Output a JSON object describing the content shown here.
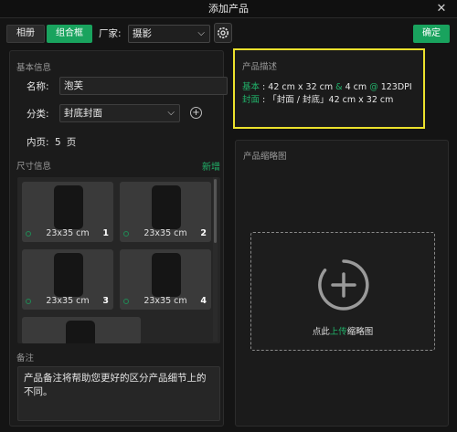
{
  "window": {
    "title": "添加产品",
    "close_glyph": "✕"
  },
  "toolbar": {
    "album_label": "相册",
    "combo_label": "组合框",
    "vendor_label": "厂家:",
    "vendor_value": "摄影",
    "confirm_label": "确定"
  },
  "basic_info": {
    "section_title": "基本信息",
    "name_label": "名称:",
    "name_value": "泡芙",
    "category_label": "分类:",
    "category_value": "封底封面",
    "pages_label": "内页:",
    "pages_value": "5",
    "pages_unit": "页"
  },
  "size_info": {
    "section_title": "尺寸信息",
    "add_label": "新增",
    "cards": [
      {
        "dims": "23x35 cm",
        "index": "1"
      },
      {
        "dims": "23x35 cm",
        "index": "2"
      },
      {
        "dims": "23x35 cm",
        "index": "3"
      },
      {
        "dims": "23x35 cm",
        "index": "4"
      }
    ]
  },
  "remarks": {
    "section_title": "备注",
    "text": "产品备注将帮助您更好的区分产品细节上的不同。"
  },
  "description": {
    "section_title": "产品描述",
    "basic_label": "基本",
    "basic_sep": ":",
    "basic_size": "42 cm x 32 cm",
    "amp": "&",
    "basic_depth": "4 cm",
    "at": "@",
    "dpi": "123DPI",
    "cover_label": "封面",
    "cover_sep": ":",
    "cover_value": "「封面 / 封底」42 cm x 32 cm"
  },
  "thumbnail": {
    "section_title": "产品缩略图",
    "upload_prefix": "点此",
    "upload_link": "上传",
    "upload_suffix": "缩略图"
  },
  "colors": {
    "accent": "#19a35e",
    "highlight_border": "#ece12c"
  },
  "icons": {
    "vendor_settings": "gear-icon",
    "add_category": "plus-circle-icon",
    "upload": "plus-circle-icon"
  }
}
